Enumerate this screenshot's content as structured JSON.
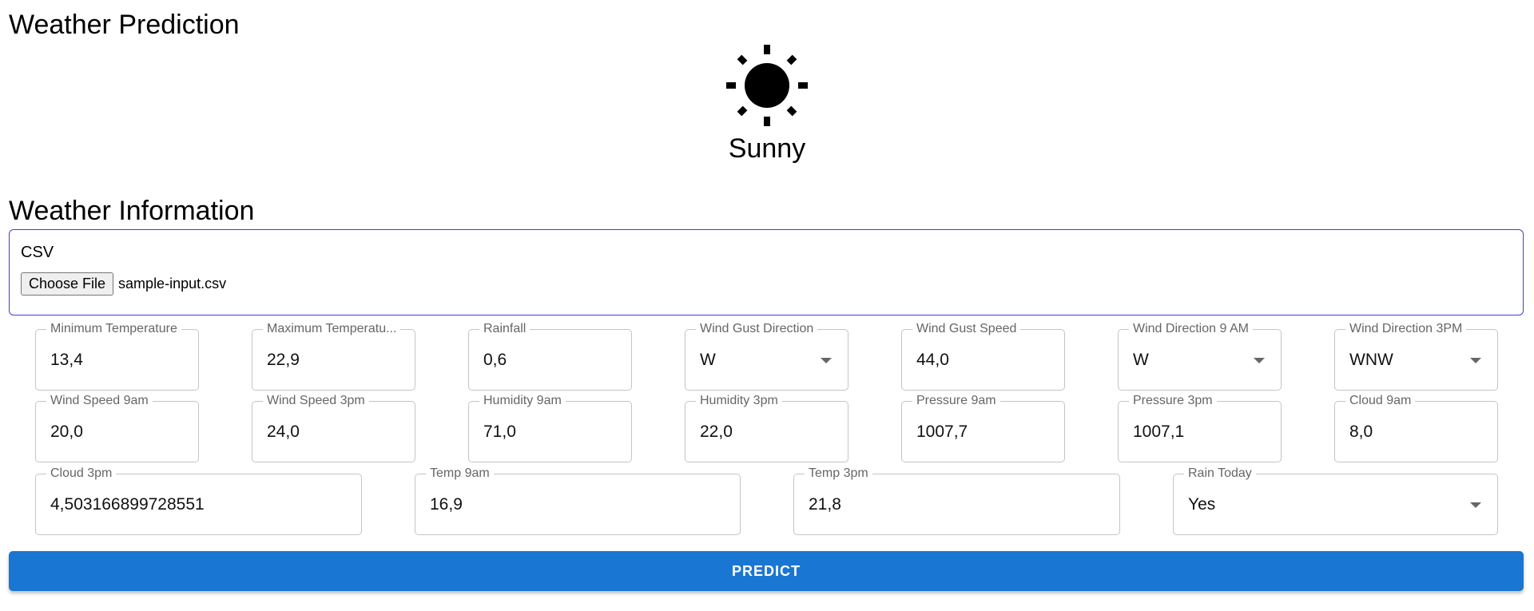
{
  "app": {
    "title": "Weather Prediction"
  },
  "prediction": {
    "icon": "sun-icon",
    "label": "Sunny"
  },
  "info": {
    "title": "Weather Information"
  },
  "csv": {
    "label": "CSV",
    "button_label": "Choose File",
    "file_name": "sample-input.csv"
  },
  "fields": {
    "min_temp": {
      "label": "Minimum Temperature",
      "value": "13,4"
    },
    "max_temp": {
      "label": "Maximum Temperatu...",
      "value": "22,9"
    },
    "rainfall": {
      "label": "Rainfall",
      "value": "0,6"
    },
    "wind_gust_dir": {
      "label": "Wind Gust Direction",
      "value": "W"
    },
    "wind_gust_speed": {
      "label": "Wind Gust Speed",
      "value": "44,0"
    },
    "wind_dir_9am": {
      "label": "Wind Direction 9 AM",
      "value": "W"
    },
    "wind_dir_3pm": {
      "label": "Wind Direction 3PM",
      "value": "WNW"
    },
    "wind_speed_9am": {
      "label": "Wind Speed 9am",
      "value": "20,0"
    },
    "wind_speed_3pm": {
      "label": "Wind Speed 3pm",
      "value": "24,0"
    },
    "humidity_9am": {
      "label": "Humidity 9am",
      "value": "71,0"
    },
    "humidity_3pm": {
      "label": "Humidity 3pm",
      "value": "22,0"
    },
    "pressure_9am": {
      "label": "Pressure 9am",
      "value": "1007,7"
    },
    "pressure_3pm": {
      "label": "Pressure 3pm",
      "value": "1007,1"
    },
    "cloud_9am": {
      "label": "Cloud 9am",
      "value": "8,0"
    },
    "cloud_3pm": {
      "label": "Cloud 3pm",
      "value": "4,503166899728551"
    },
    "temp_9am": {
      "label": "Temp 9am",
      "value": "16,9"
    },
    "temp_3pm": {
      "label": "Temp 3pm",
      "value": "21,8"
    },
    "rain_today": {
      "label": "Rain Today",
      "value": "Yes"
    }
  },
  "actions": {
    "predict_label": "PREDICT"
  },
  "colors": {
    "primary": "#1976d2",
    "csv_border": "#3f3fd8",
    "field_border": "#c4c4c4"
  }
}
